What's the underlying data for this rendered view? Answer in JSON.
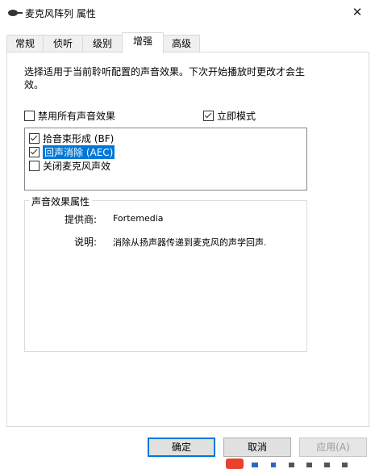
{
  "window": {
    "title": "麦克风阵列 属性",
    "close_glyph": "✕"
  },
  "tabs": [
    {
      "label": "常规"
    },
    {
      "label": "侦听"
    },
    {
      "label": "级别"
    },
    {
      "label": "增强",
      "active": true
    },
    {
      "label": "高级"
    }
  ],
  "enhancement": {
    "description": "选择适用于当前聆听配置的声音效果。下次开始播放时更改才会生效。",
    "disable_all_label": "禁用所有声音效果",
    "disable_all_checked": false,
    "immediate_mode_label": "立即模式",
    "immediate_mode_checked": true,
    "effects": [
      {
        "label": "拾音束形成 (BF)",
        "checked": true,
        "selected": false
      },
      {
        "label": "回声消除 (AEC)",
        "checked": true,
        "selected": true
      },
      {
        "label": "关闭麦克风声效",
        "checked": false,
        "selected": false
      }
    ]
  },
  "properties": {
    "group_title": "声音效果属性",
    "provider_label": "提供商:",
    "provider_value": "Fortemedia",
    "description_label": "说明:",
    "description_value": "消除从扬声器传递到麦克风的声学回声."
  },
  "buttons": {
    "ok": "确定",
    "cancel": "取消",
    "apply": "应用(A)"
  },
  "colors": {
    "selection": "#0078d7",
    "default_button_border": "#0078d7"
  }
}
